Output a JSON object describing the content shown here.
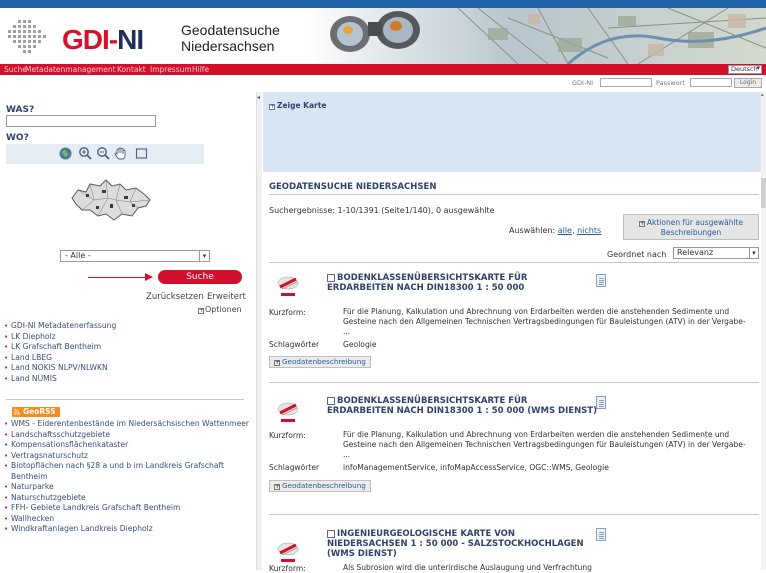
{
  "header": {
    "logo_main": "GDI-",
    "logo_ni": "NI",
    "subtitle_line1": "Geodatensuche",
    "subtitle_line2": "Niedersachsen"
  },
  "nav": {
    "items": [
      "Suche",
      "Metadatenmanagement",
      "Kontakt",
      "Impressum",
      "Hilfe"
    ],
    "language": "Deutsch"
  },
  "login": {
    "gdi_label": "GDI-NI",
    "password_label": "Passwort",
    "button_label": "Login"
  },
  "sidebar": {
    "was_label": "WAS?",
    "wo_label": "WO?",
    "region_value": "- Alle -",
    "search_button": "Suche",
    "reset_link": "Zurücksetzen",
    "extend_link": "Erweitert",
    "options_link": "Optionen",
    "sources": [
      "GDI-NI Metadatenerfassung",
      "LK Diepholz",
      "LK Grafschaft Bentheim",
      "Land LBEG",
      "Land NOKIS NLPV/NLWKN",
      "Land NUMIS"
    ],
    "georss_label": "GeoRSS",
    "feeds": [
      "WMS - Eiderentenbestände im Niedersächsischen Wattenmeer",
      "Landschaftsschutzgebiete",
      "Kompensationsflächenkataster",
      "Vertragsnaturschutz",
      "Biotopflächen nach §28 a und b im Landkreis Grafschaft Bentheim",
      "Naturparke",
      "Naturschutzgebiete",
      "FFH- Gebiete Landkreis Grafschaft Bentheim",
      "Wallhecken",
      "Windkraftanlagen Landkreis Diepholz"
    ]
  },
  "main": {
    "show_map": "Zeige Karte",
    "results_title": "GEODATENSUCHE NIEDERSACHSEN",
    "results_count": "Suchergebnisse:  1-10/1391  (Seite1/140),  0 ausgewählte",
    "select_label": "Auswählen:",
    "select_all": "alle",
    "select_none": "nichts",
    "actions_line1": "Aktionen für ausgewählte",
    "actions_line2": "Beschreibungen",
    "sort_label": "Geordnet nach",
    "sort_value": "Relevanz",
    "kurzform_label": "Kurzform:",
    "schlagworter_label": "Schlagwörter",
    "geo_button": "Geodatenbeschreibung",
    "results": [
      {
        "title": "BODENKLASSENÜBERSICHTSKARTE FÜR ERDARBEITEN NACH DIN18300 1 : 50 000",
        "kurzform": "Für die Planung, Kalkulation und Abrechnung von Erdarbeiten werden die anstehenden Sedimente und Gesteine nach den Allgemeinen Technischen Vertragsbedingungen für Bauleistungen (ATV) in der Vergabe- ...",
        "schlagworter": "Geologie"
      },
      {
        "title": "BODENKLASSENÜBERSICHTSKARTE FÜR ERDARBEITEN NACH DIN18300 1 : 50 000 (WMS DIENST)",
        "kurzform": "Für die Planung, Kalkulation und Abrechnung von Erdarbeiten werden die anstehenden Sedimente und Gesteine nach den Allgemeinen Technischen Vertragsbedingungen für Bauleistungen (ATV) in der Vergabe- ...",
        "schlagworter": "infoManagementService, infoMapAccessService, OGC::WMS, Geologie"
      },
      {
        "title": "INGENIEURGEOLOGISCHE KARTE VON NIEDERSACHSEN 1 : 50 000 - SALZSTOCKHOCHLAGEN (WMS DIENST)",
        "kurzform": "Als Subrosion wird die unterirdische Auslaugung und Verfrachtung",
        "schlagworter": ""
      }
    ]
  },
  "colors": {
    "brand_red": "#d2102b",
    "brand_blue": "#1f63a8",
    "heading_navy": "#30426b",
    "map_panel": "#d8e5f2"
  }
}
